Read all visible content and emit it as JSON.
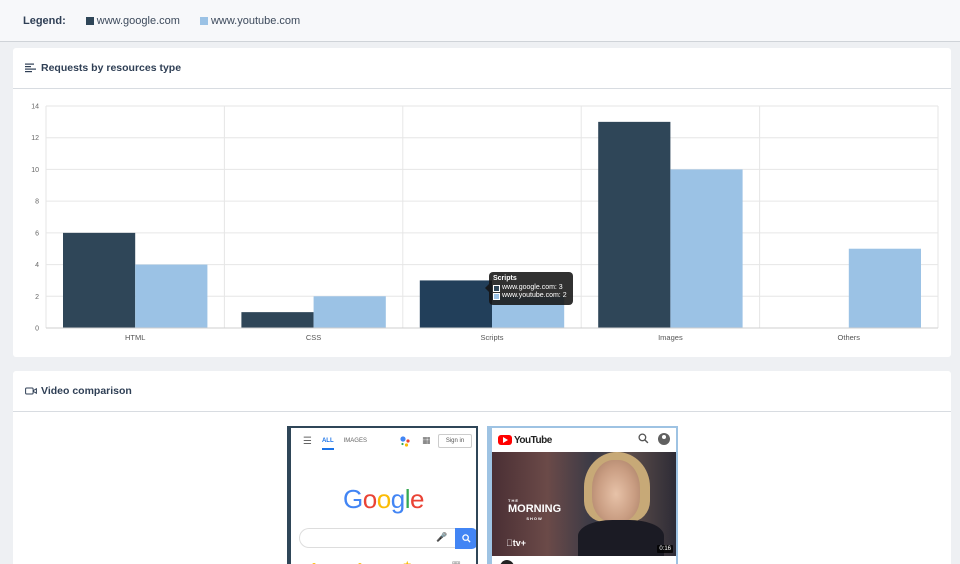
{
  "legend": {
    "title": "Legend:",
    "items": [
      {
        "label": "www.google.com",
        "color": "#2f4658"
      },
      {
        "label": "www.youtube.com",
        "color": "#9bc2e5"
      }
    ]
  },
  "chart_card": {
    "title": "Requests by resources type"
  },
  "chart_data": {
    "type": "bar",
    "categories": [
      "HTML",
      "CSS",
      "Scripts",
      "Images",
      "Others"
    ],
    "series": [
      {
        "name": "www.google.com",
        "color": "#2f4658",
        "values": [
          6,
          1,
          3,
          13,
          0
        ]
      },
      {
        "name": "www.youtube.com",
        "color": "#9bc2e5",
        "values": [
          4,
          2,
          2,
          10,
          5
        ]
      }
    ],
    "ylim": [
      0,
      14
    ],
    "yticks": [
      0,
      2,
      4,
      6,
      8,
      10,
      12,
      14
    ],
    "grid": true,
    "tooltip": {
      "title": "Scripts",
      "rows": [
        "www.google.com: 3",
        "www.youtube.com: 2"
      ]
    }
  },
  "video_card": {
    "title": "Video comparison"
  },
  "google_frame": {
    "tab_all": "ALL",
    "tab_images": "IMAGES",
    "signin": "Sign in",
    "logo": [
      "G",
      "o",
      "o",
      "g",
      "l",
      "e"
    ],
    "logo_colors": [
      "#4285f4",
      "#ea4335",
      "#fbbc05",
      "#4285f4",
      "#34a853",
      "#ea4335"
    ]
  },
  "youtube_frame": {
    "logo": "YouTube",
    "show_pre": "THE",
    "show_title": "MORNING",
    "show_sub": "SHOW",
    "appletv": "tv+",
    "duration": "0:16"
  }
}
